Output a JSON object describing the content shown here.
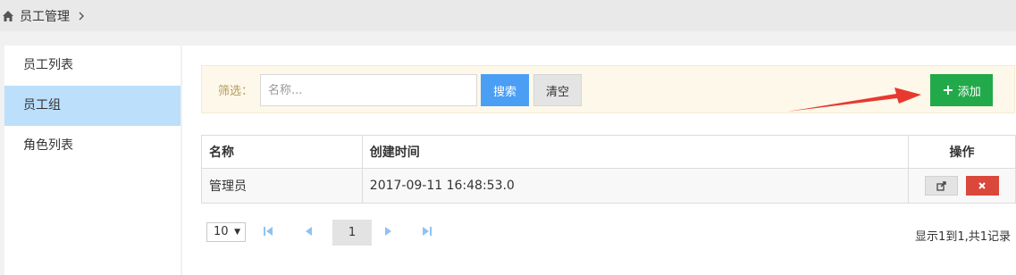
{
  "breadcrumb": {
    "label": "员工管理"
  },
  "sidebar": {
    "items": [
      {
        "label": "员工列表",
        "active": false
      },
      {
        "label": "员工组",
        "active": true
      },
      {
        "label": "角色列表",
        "active": false
      }
    ]
  },
  "filter": {
    "label": "筛选：",
    "placeholder": "名称...",
    "value": "",
    "search_label": "搜索",
    "clear_label": "清空",
    "add_label": "添加"
  },
  "table": {
    "headers": [
      "名称",
      "创建时间",
      "操作"
    ],
    "rows": [
      {
        "name": "管理员",
        "created": "2017-09-11 16:48:53.0"
      }
    ]
  },
  "pagination": {
    "page_size": "10",
    "current_page": "1",
    "record_info": "显示1到1,共1记录"
  },
  "colors": {
    "accent_blue": "#4a9ff5",
    "add_green": "#22a94a",
    "delete_red": "#d9483b",
    "active_sidebar": "#bcdffb",
    "annotation_arrow": "#e8392f"
  }
}
